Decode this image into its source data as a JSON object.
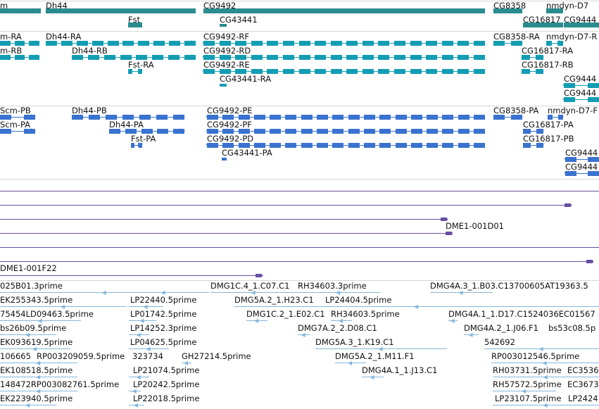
{
  "colors": {
    "gene": "#2a8c8f",
    "transcript_teal": "#139db3",
    "transcript_blue": "#3a72cf",
    "alignment": "#6a4ea3",
    "est": "#85b6da",
    "separator": "#d6d6d6",
    "text": "#111111"
  },
  "tracks": [
    {
      "id": "genes",
      "color_key": "gene",
      "features": [
        {
          "label": "m",
          "strand": "+"
        },
        {
          "label": "Dh44",
          "strand": "+"
        },
        {
          "label": "Fst",
          "strand": "+"
        },
        {
          "label": "CG9492",
          "strand": "+"
        },
        {
          "label": "CG43441",
          "strand": "-"
        },
        {
          "label": "CG8358",
          "strand": "+"
        },
        {
          "label": "nmdyn-D7",
          "strand": "+"
        },
        {
          "label": "CG16817",
          "strand": "+"
        },
        {
          "label": "CG9444",
          "strand": "+"
        }
      ]
    },
    {
      "id": "transcripts-a",
      "color_key": "transcript_teal",
      "features": [
        {
          "label": "m-RA",
          "strand": "+"
        },
        {
          "label": "m-RB",
          "strand": "+"
        },
        {
          "label": "Dh44-RA",
          "strand": "+"
        },
        {
          "label": "Dh44-RB",
          "strand": "+"
        },
        {
          "label": "Fst-RA",
          "strand": "+"
        },
        {
          "label": "CG9492-RF",
          "strand": "-"
        },
        {
          "label": "CG9492-RD",
          "strand": "-"
        },
        {
          "label": "CG9492-RE",
          "strand": "-"
        },
        {
          "label": "CG43441-RA",
          "strand": "-"
        },
        {
          "label": "CG8358-RA",
          "strand": "+"
        },
        {
          "label": "nmdyn-D7-R",
          "strand": "+"
        },
        {
          "label": "CG16817-RA",
          "strand": "+"
        },
        {
          "label": "CG16817-RB",
          "strand": "+"
        },
        {
          "label": "CG9444",
          "strand": "-"
        },
        {
          "label": "CG9444",
          "strand": "-"
        }
      ]
    },
    {
      "id": "transcripts-b",
      "color_key": "transcript_blue",
      "features": [
        {
          "label": "Scm-PB",
          "strand": "+"
        },
        {
          "label": "Scm-PA",
          "strand": "+"
        },
        {
          "label": "Dh44-PB",
          "strand": "+"
        },
        {
          "label": "Dh44-PA",
          "strand": "+"
        },
        {
          "label": "Fst-PA",
          "strand": "+"
        },
        {
          "label": "CG9492-PE",
          "strand": "-"
        },
        {
          "label": "CG9492-PF",
          "strand": "-"
        },
        {
          "label": "CG9492-PD",
          "strand": "-"
        },
        {
          "label": "CG43441-PA",
          "strand": "-"
        },
        {
          "label": "CG8358-PA",
          "strand": "+"
        },
        {
          "label": "nmdyn-D7-F",
          "strand": "+"
        },
        {
          "label": "CG16817-PA",
          "strand": "+"
        },
        {
          "label": "CG16817-PB",
          "strand": "+"
        },
        {
          "label": "CG9444",
          "strand": "-"
        },
        {
          "label": "CG9444",
          "strand": "-"
        }
      ]
    },
    {
      "id": "alignments",
      "color_key": "alignment",
      "features": [
        {
          "label": "",
          "strand": "+"
        },
        {
          "label": "",
          "strand": "+"
        },
        {
          "label": "DME1-001D01",
          "strand": "+"
        },
        {
          "label": "",
          "strand": "+"
        },
        {
          "label": "",
          "strand": "+"
        },
        {
          "label": "",
          "strand": "+"
        },
        {
          "label": "DME1-001F22",
          "strand": "+"
        }
      ]
    },
    {
      "id": "ests",
      "color_key": "est",
      "features": [
        {
          "label": "025B01.3prime"
        },
        {
          "label": "EK255343.5prime"
        },
        {
          "label": "75454LD09463.5prime"
        },
        {
          "label": "bs26b09.5prime"
        },
        {
          "label": "EK093619.5prime"
        },
        {
          "label": "106665"
        },
        {
          "label": "RP003209059.5prime"
        },
        {
          "label": "EK108518.5prime"
        },
        {
          "label": "148472RP003082761.5prime"
        },
        {
          "label": "EK223940.5prime"
        },
        {
          "label": "LP22440.5prime"
        },
        {
          "label": "LP01742.5prime"
        },
        {
          "label": "LP14252.3prime"
        },
        {
          "label": "LP04625.5prime"
        },
        {
          "label": "323734"
        },
        {
          "label": "GH27214.5prime"
        },
        {
          "label": "LP21074.5prime"
        },
        {
          "label": "LP20242.5prime"
        },
        {
          "label": "LP22018.5prime"
        },
        {
          "label": "DMG1C.4_1.C07.C1"
        },
        {
          "label": "RH34603.3prime"
        },
        {
          "label": "DMG5A.2_1.H23.C1"
        },
        {
          "label": "LP24404.5prime"
        },
        {
          "label": "DMG1C.2_1.E02.C1"
        },
        {
          "label": "RH34603.5prime"
        },
        {
          "label": "DMG7A.2_2.D08.C1"
        },
        {
          "label": "DMG5A.3_1.K19.C1"
        },
        {
          "label": "DMG5A.2_1.M11.F1"
        },
        {
          "label": "DMG4A.1_1.J13.C1"
        },
        {
          "label": "DMG4A.3_1.B03.C13700605AT19363.5"
        },
        {
          "label": "DMG4A.1_1.D17.C1524036EC01567"
        },
        {
          "label": "DMG4A.2_1.J06.F1"
        },
        {
          "label": "bs53c08.5p"
        },
        {
          "label": "542692"
        },
        {
          "label": "RP003012546.5prime"
        },
        {
          "label": "RH03731.5prime"
        },
        {
          "label": "EC3536"
        },
        {
          "label": "RH57572.5prime"
        },
        {
          "label": "EC3673"
        },
        {
          "label": "LP23107.5prime"
        },
        {
          "label": "LP2424"
        }
      ]
    }
  ]
}
